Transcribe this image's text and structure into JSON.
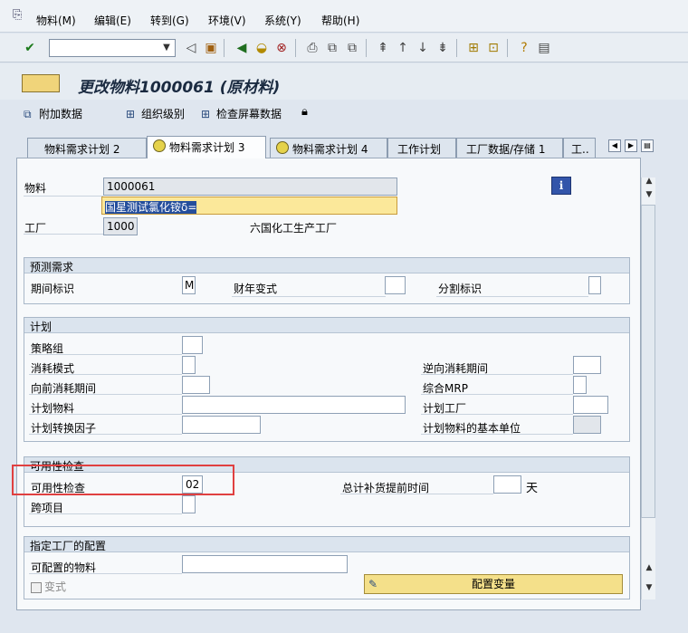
{
  "menubar": {
    "items": [
      "物料(M)",
      "编辑(E)",
      "转到(G)",
      "环境(V)",
      "系统(Y)",
      "帮助(H)"
    ]
  },
  "toolbar": {
    "command_value": ""
  },
  "title": "更改物料1000061 (原材料)",
  "app_toolbar": {
    "additional_data": "附加数据",
    "org_levels": "组织级别",
    "check_screen_data": "检查屏幕数据"
  },
  "tabs": [
    {
      "label": "物料需求计划 2"
    },
    {
      "label": "物料需求计划 3"
    },
    {
      "label": "物料需求计划 4"
    },
    {
      "label": "工作计划"
    },
    {
      "label": "工厂数据/存储 1"
    },
    {
      "label": "工.."
    }
  ],
  "header": {
    "material_label": "物料",
    "material_value": "1000061",
    "description": "国星测试氯化铵δ=",
    "plant_label": "工厂",
    "plant_value": "1000",
    "plant_name": "六国化工生产工厂"
  },
  "forecast": {
    "title": "预测需求",
    "period_label": "期间标识",
    "period_value": "M",
    "fiscal_variant_label": "财年变式",
    "split_label": "分割标识"
  },
  "planning": {
    "title": "计划",
    "strategy_group": "策略组",
    "consumption_mode": "消耗模式",
    "fwd_period": "向前消耗期间",
    "planning_material": "计划物料",
    "planning_conv_factor": "计划转换因子",
    "bwd_period": "逆向消耗期间",
    "mixed_mrp": "综合MRP",
    "planning_plant": "计划工厂",
    "planning_base_unit": "计划物料的基本单位"
  },
  "availability": {
    "title": "可用性检查",
    "check_label": "可用性检查",
    "check_value": "02",
    "total_repl_lead_time": "总计补货提前时间",
    "days_unit": "天",
    "cross_project": "跨项目"
  },
  "plant_config": {
    "title": "指定工厂的配置",
    "configurable_material": "可配置的物料",
    "variant": "变式",
    "config_button": "配置变量"
  }
}
